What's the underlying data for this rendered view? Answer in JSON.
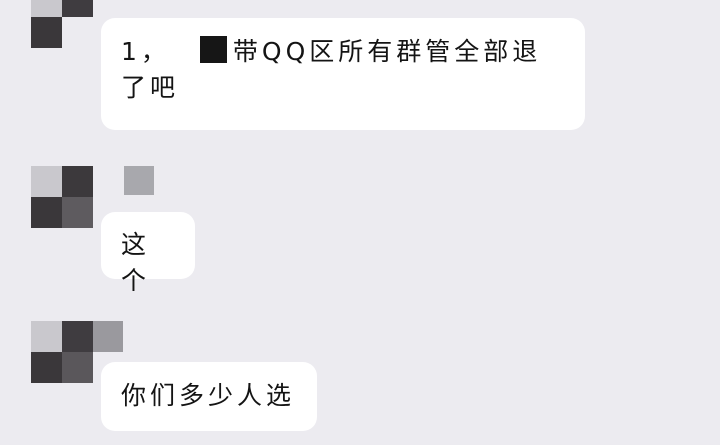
{
  "chat": {
    "messages": [
      {
        "prefix": "1，",
        "text": "带QQ区所有群管全部退了吧",
        "redacted": true
      },
      {
        "text": "这个"
      },
      {
        "text": "你们多少人选"
      }
    ]
  },
  "colors": {
    "background": "#ecebf0",
    "bubble": "#ffffff",
    "text": "#141414",
    "mosaic_dark": "#3a373a",
    "mosaic_mid": "#6b686c",
    "mosaic_light": "#c9c8cd"
  },
  "icons": [
    "avatar-mosaic",
    "redaction-block"
  ]
}
